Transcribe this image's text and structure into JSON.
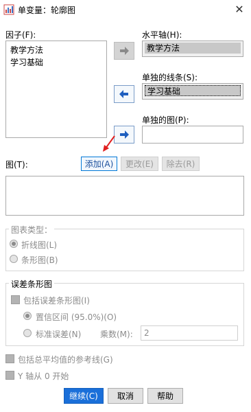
{
  "window": {
    "title": "单变量：轮廓图",
    "close_glyph": "✕"
  },
  "factors": {
    "label": "因子(F):",
    "items": [
      "教学方法",
      "学习基础"
    ]
  },
  "targets": {
    "horizontal": {
      "label": "水平轴(H):",
      "value": "教学方法"
    },
    "lines": {
      "label": "单独的线条(S):",
      "value": "学习基础"
    },
    "plots": {
      "label": "单独的图(P):",
      "value": ""
    }
  },
  "plots": {
    "label": "图(T):",
    "add_label": "添加(A)",
    "change_label": "更改(E)",
    "remove_label": "除去(R)"
  },
  "chart_type": {
    "title": "图表类型：",
    "line_label": "折线图(L)",
    "bar_label": "条形图(B)",
    "selected": "line"
  },
  "error_bars": {
    "title": "误差条形图",
    "include_label": "包括误差条形图(I)",
    "ci_label": "置信区间 (95.0%)(O)",
    "se_label": "标准误差(N)",
    "multiplier_label": "乘数(M):",
    "multiplier_value": "2"
  },
  "options": {
    "grand_mean_label": "包括总平均值的参考线(G)",
    "y_axis_label": "Y 轴从 0 开始"
  },
  "footer": {
    "continue_label": "继续(C)",
    "cancel_label": "取消",
    "help_label": "帮助"
  },
  "colors": {
    "accent": "#1a6fd9",
    "annotation_arrow": "#e02020",
    "arrow_blue": "#1f5fbf"
  }
}
